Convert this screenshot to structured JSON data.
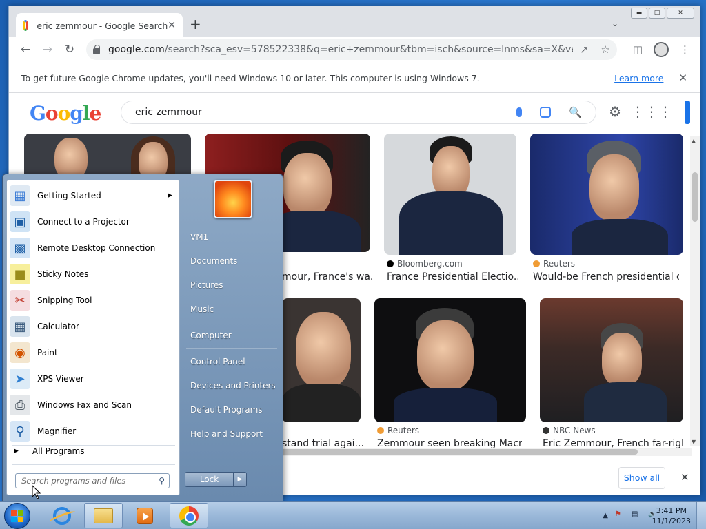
{
  "browser": {
    "tab_title": "eric zemmour - Google Search",
    "tab_close": "✕",
    "new_tab": "+",
    "url_host": "google.com",
    "url_rest": "/search?sca_esv=578522338&q=eric+zemmour&tbm=isch&source=lnms&sa=X&ved=2ahUKE...",
    "infobar_message": "To get future Google Chrome updates, you'll need Windows 10 or later. This computer is using Windows 7.",
    "infobar_link": "Learn more",
    "infobar_close": "✕"
  },
  "google": {
    "search_query": "eric zemmour",
    "logo_letters": [
      "G",
      "o",
      "o",
      "g",
      "l",
      "e"
    ],
    "results": [
      {
        "source": "",
        "caption": ""
      },
      {
        "source": "",
        "caption": "mour, France's wa..."
      },
      {
        "source": "Bloomberg.com",
        "caption": "France Presidential Electio..."
      },
      {
        "source": "Reuters",
        "caption": "Would-be French presidential c..."
      },
      {
        "source": "",
        "caption": "stand trial agai..."
      },
      {
        "source": "Reuters",
        "caption": "Zemmour seen breaking Macro..."
      },
      {
        "source": "NBC News",
        "caption": "Eric Zemmour, French far-righ..."
      }
    ],
    "show_all": "Show all",
    "show_all_close": "✕"
  },
  "start_menu": {
    "programs": [
      {
        "label": "Getting Started",
        "icon": "getting-started-icon",
        "has_submenu": true
      },
      {
        "label": "Connect to a Projector",
        "icon": "projector-icon"
      },
      {
        "label": "Remote Desktop Connection",
        "icon": "remote-desktop-icon"
      },
      {
        "label": "Sticky Notes",
        "icon": "sticky-notes-icon"
      },
      {
        "label": "Snipping Tool",
        "icon": "snipping-tool-icon"
      },
      {
        "label": "Calculator",
        "icon": "calculator-icon"
      },
      {
        "label": "Paint",
        "icon": "paint-icon"
      },
      {
        "label": "XPS Viewer",
        "icon": "xps-viewer-icon"
      },
      {
        "label": "Windows Fax and Scan",
        "icon": "fax-scan-icon"
      },
      {
        "label": "Magnifier",
        "icon": "magnifier-icon"
      }
    ],
    "all_programs": "All Programs",
    "search_placeholder": "Search programs and files",
    "right_links": [
      "VM1",
      "Documents",
      "Pictures",
      "Music",
      "Computer",
      "Control Panel",
      "Devices and Printers",
      "Default Programs",
      "Help and Support"
    ],
    "lock_label": "Lock"
  },
  "taskbar": {
    "time": "3:41 PM",
    "date": "11/1/2023"
  }
}
